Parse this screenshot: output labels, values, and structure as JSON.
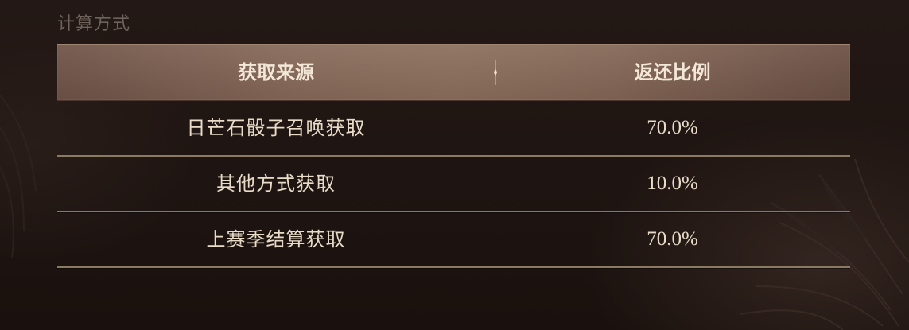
{
  "section": {
    "title": "计算方式"
  },
  "table": {
    "headers": {
      "source": "获取来源",
      "ratio": "返还比例"
    },
    "rows": [
      {
        "source": "日芒石骰子召唤获取",
        "ratio": "70.0%"
      },
      {
        "source": "其他方式获取",
        "ratio": "10.0%"
      },
      {
        "source": "上赛季结算获取",
        "ratio": "70.0%"
      }
    ]
  },
  "colors": {
    "background": "#1e1411",
    "header_bar": "#886a5a",
    "header_text": "#f3e8d8",
    "row_text": "#e8dcc8",
    "row_divider": "#8b7a62",
    "section_title": "#6e625a"
  },
  "icons": {
    "background_decoration": "feather-decoration-icon",
    "header_divider": "ornament-divider-icon"
  }
}
